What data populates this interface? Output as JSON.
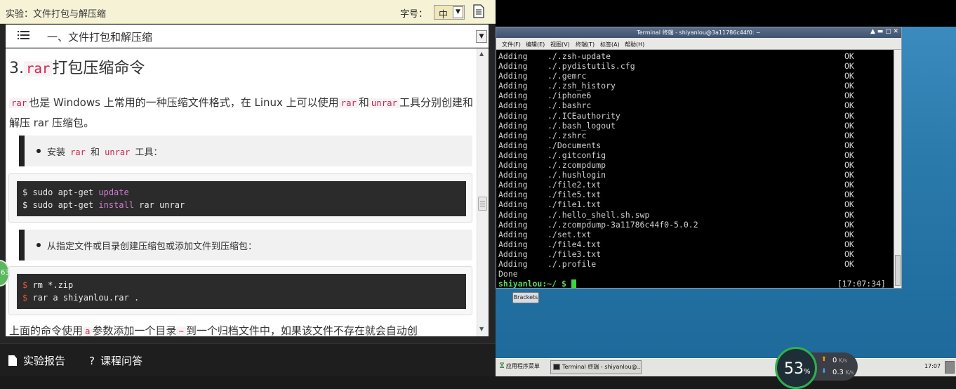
{
  "header": {
    "title": "实验：文件打包与解压缩",
    "font_size_label": "字号：",
    "font_size_value": "中"
  },
  "toc": {
    "current_section": "一、文件打包和解压缩"
  },
  "content": {
    "heading_num": "3.",
    "heading_code": "rar",
    "heading_text": "打包压缩命令",
    "para": {
      "c1": "rar",
      "t1": "也是 Windows 上常用的一种压缩文件格式，在 Linux 上可以使用",
      "c2": "rar",
      "t2": "和",
      "c3": "unrar",
      "t3": "工具分别创建和解压 rar 压缩包。"
    },
    "note1": {
      "t1": "安装",
      "c1": "rar",
      "t2": "和",
      "c2": "unrar",
      "t3": "工具："
    },
    "code1": {
      "l1_prompt": "$ sudo apt-get ",
      "l1_kw": "update",
      "l2_prompt": "$ sudo apt-get ",
      "l2_kw": "install",
      "l2_rest": " rar unrar"
    },
    "note2": {
      "t1": "从指定文件或目录创建压缩包或添加文件到压缩包："
    },
    "code2": {
      "l1_sign": "$",
      "l1_rest": " rm *.zip",
      "l2_sign": "$",
      "l2_rest": " rar a shiyanlou.rar ."
    },
    "bottom": {
      "t1": "上面的命令使用",
      "c1": "a",
      "t2": "参数添加一个目录",
      "c2": "~",
      "t3": "到一个归档文件中，如果该文件不存在就会自动创"
    },
    "badge_text": "63"
  },
  "footer": {
    "report": "实验报告",
    "qa": "课程问答"
  },
  "terminal": {
    "title": "Terminal 终端 - shiyanlou@3a11786c44f0: ~",
    "menu": [
      "文件(F)",
      "编辑(E)",
      "视图(V)",
      "终端(T)",
      "标签(A)",
      "帮助(H)"
    ],
    "lines": [
      {
        "action": "Adding",
        "file": "./.zsh-update",
        "status": "OK"
      },
      {
        "action": "Adding",
        "file": "./.pydistutils.cfg",
        "status": "OK"
      },
      {
        "action": "Adding",
        "file": "./.gemrc",
        "status": "OK"
      },
      {
        "action": "Adding",
        "file": "./.zsh_history",
        "status": "OK"
      },
      {
        "action": "Adding",
        "file": "./iphone6",
        "status": "OK"
      },
      {
        "action": "Adding",
        "file": "./.bashrc",
        "status": "OK"
      },
      {
        "action": "Adding",
        "file": "./.ICEauthority",
        "status": "OK"
      },
      {
        "action": "Adding",
        "file": "./.bash_logout",
        "status": "OK"
      },
      {
        "action": "Adding",
        "file": "./.zshrc",
        "status": "OK"
      },
      {
        "action": "Adding",
        "file": "./Documents",
        "status": "OK"
      },
      {
        "action": "Adding",
        "file": "./.gitconfig",
        "status": "OK"
      },
      {
        "action": "Adding",
        "file": "./.zcompdump",
        "status": "OK"
      },
      {
        "action": "Adding",
        "file": "./.hushlogin",
        "status": "OK"
      },
      {
        "action": "Adding",
        "file": "./file2.txt",
        "status": "OK"
      },
      {
        "action": "Adding",
        "file": "./file5.txt",
        "status": "OK"
      },
      {
        "action": "Adding",
        "file": "./file1.txt",
        "status": "OK"
      },
      {
        "action": "Adding",
        "file": "./.hello_shell.sh.swp",
        "status": "OK"
      },
      {
        "action": "Adding",
        "file": "./.zcompdump-3a11786c44f0-5.0.2",
        "status": "OK"
      },
      {
        "action": "Adding",
        "file": "./set.txt",
        "status": "OK"
      },
      {
        "action": "Adding",
        "file": "./file4.txt",
        "status": "OK"
      },
      {
        "action": "Adding",
        "file": "./file3.txt",
        "status": "OK"
      },
      {
        "action": "Adding",
        "file": "./.profile",
        "status": "OK"
      }
    ],
    "done": "Done",
    "prompt": "shiyanlou:~/ $",
    "clock": "[17:07:34]"
  },
  "desktop": {
    "brackets_label": "Brackets"
  },
  "taskbar": {
    "start": "应用程序菜单",
    "terminal_task": "Terminal 终端 - shiyanlou@...",
    "clock": "17:07"
  },
  "monitor": {
    "cpu": "53",
    "cpu_unit": "%",
    "up": "0",
    "up_unit": "K/s",
    "down": "0.3",
    "down_unit": "K/s"
  }
}
